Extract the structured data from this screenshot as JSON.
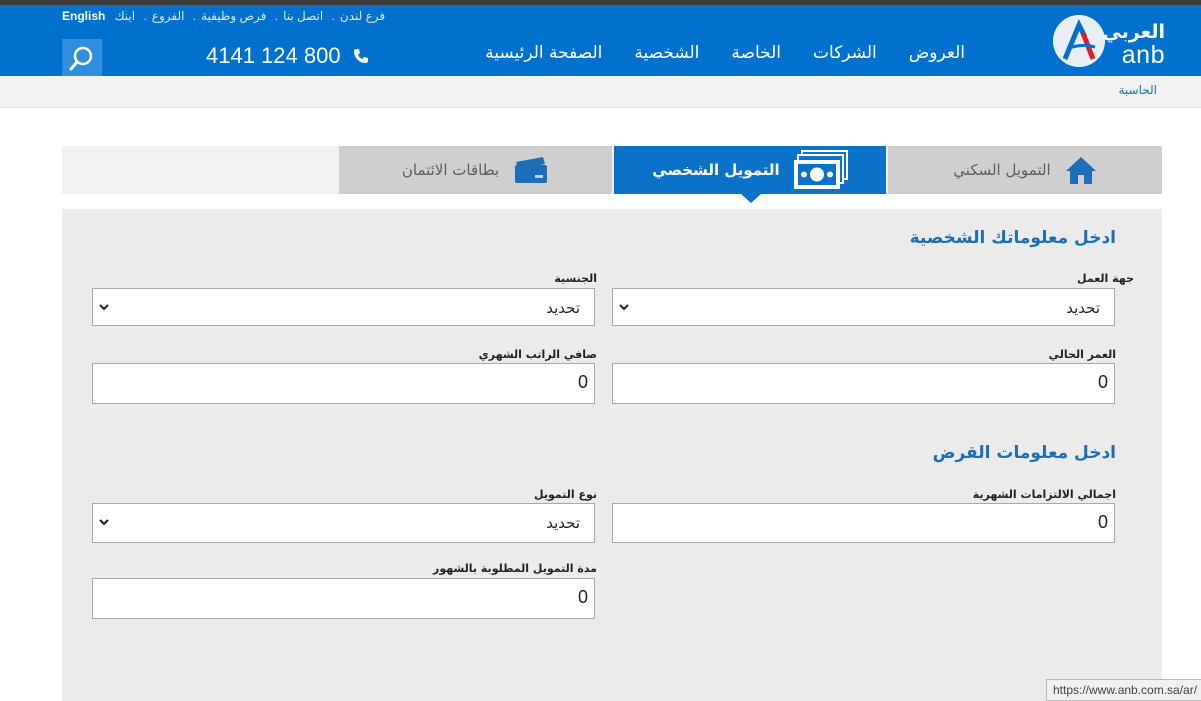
{
  "header": {
    "logo_ar": "العربي",
    "logo_en": "anb",
    "utility_links": [
      "English",
      "فرع لندن",
      "اتصل بنا",
      "فرص وظيفية",
      "الفروع",
      "اينك"
    ],
    "nav": [
      "الصفحة الرئيسية",
      "الشخصية",
      "الخاصة",
      "الشركات",
      "العروض"
    ],
    "phone": "4141 124 800",
    "colors": {
      "brand": "#0071ce"
    }
  },
  "breadcrumb": "الحاسبة",
  "tabs": [
    {
      "label": "التمويل السكني",
      "icon": "home-icon"
    },
    {
      "label": "التمويل الشخصي",
      "icon": "cash-icon",
      "active": true
    },
    {
      "label": "بطاقات الائتمان",
      "icon": "credit-card-icon"
    }
  ],
  "form": {
    "personal_heading": "ادخل معلوماتك الشخصية",
    "employer_label": "جهة العمل",
    "employer_value": "تحديد",
    "nationality_label": "الجنسية",
    "nationality_value": "تحديد",
    "age_label": "العمر الحالي",
    "age_value": "0",
    "salary_label": "صافي الراتب الشهري",
    "salary_value": "0",
    "loan_heading": "ادخل معلومات القرض",
    "obligations_label": "اجمالي الالتزامات الشهرية",
    "obligations_value": "0",
    "finance_type_label": "نوع التمويل",
    "finance_type_value": "تحديد",
    "duration_label": "مدة التمويل المطلوبة بالشهور",
    "duration_value": "0"
  },
  "status_url": "https://www.anb.com.sa/ar/"
}
